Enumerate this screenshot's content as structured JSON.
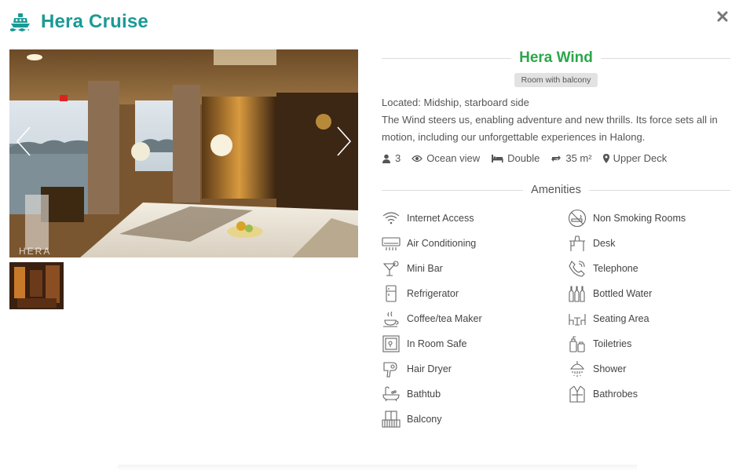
{
  "header": {
    "brand_icon": "ship-icon",
    "brand_title": "Hera Cruise",
    "close_icon": "close-icon"
  },
  "gallery": {
    "watermark": "HERA",
    "prev_icon": "chevron-left-icon",
    "next_icon": "chevron-right-icon",
    "thumbnail_count": 1
  },
  "room": {
    "name": "Hera Wind",
    "badge": "Room with balcony",
    "location": "Located: Midship, starboard side",
    "description": "The Wind steers us, enabling adventure and new thrills. Its force sets all in motion, including our unforgettable experiences in Halong.",
    "specs": {
      "guests": "3",
      "view": "Ocean view",
      "bed": "Double",
      "size": "35 m²",
      "deck": "Upper Deck"
    }
  },
  "amenities": {
    "title": "Amenities",
    "left": [
      {
        "label": "Internet Access",
        "icon": "wifi-icon"
      },
      {
        "label": "Air Conditioning",
        "icon": "air-conditioner-icon"
      },
      {
        "label": "Mini Bar",
        "icon": "cocktail-icon"
      },
      {
        "label": "Refrigerator",
        "icon": "fridge-icon"
      },
      {
        "label": "Coffee/tea Maker",
        "icon": "coffee-icon"
      },
      {
        "label": "In Room Safe",
        "icon": "safe-icon"
      },
      {
        "label": "Hair Dryer",
        "icon": "hair-dryer-icon"
      },
      {
        "label": "Bathtub",
        "icon": "bathtub-icon"
      },
      {
        "label": "Balcony",
        "icon": "balcony-icon"
      }
    ],
    "right": [
      {
        "label": "Non Smoking Rooms",
        "icon": "no-smoking-icon"
      },
      {
        "label": "Desk",
        "icon": "desk-icon"
      },
      {
        "label": "Telephone",
        "icon": "telephone-icon"
      },
      {
        "label": "Bottled Water",
        "icon": "bottles-icon"
      },
      {
        "label": "Seating Area",
        "icon": "seating-icon"
      },
      {
        "label": "Toiletries",
        "icon": "toiletries-icon"
      },
      {
        "label": "Shower",
        "icon": "shower-icon"
      },
      {
        "label": "Bathrobes",
        "icon": "bathrobe-icon"
      }
    ]
  },
  "colors": {
    "brand": "#1a9a96",
    "room_name": "#2ca64a",
    "text": "#555555",
    "badge_bg": "#e2e2e2"
  }
}
